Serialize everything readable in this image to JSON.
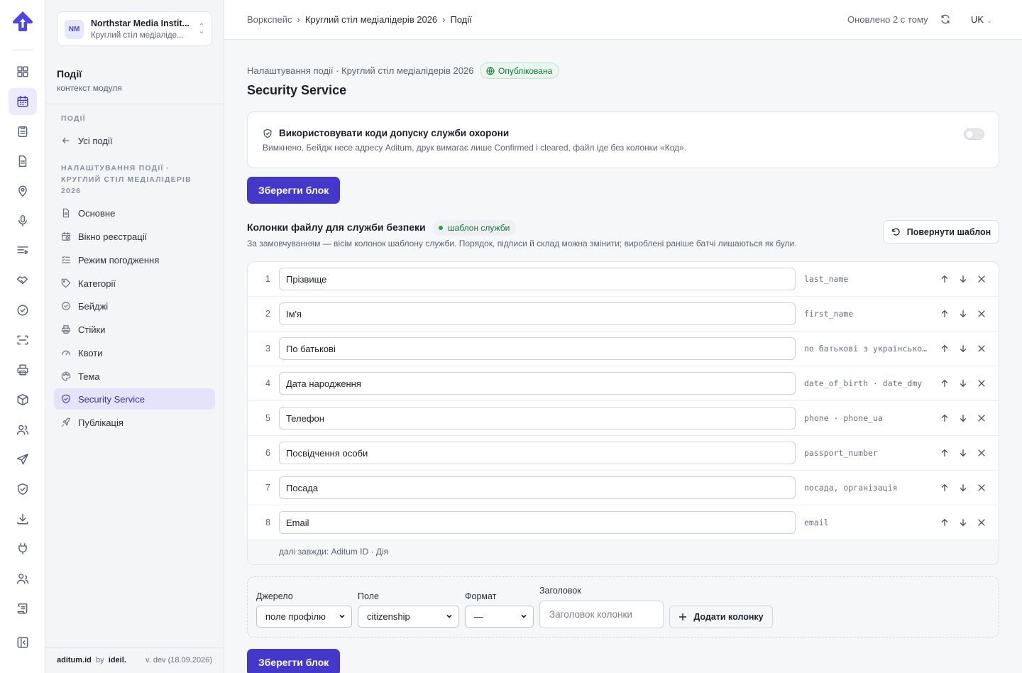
{
  "colors": {
    "accent": "#4338ca",
    "published": "#16733a"
  },
  "rail": {
    "icons": [
      "dashboard-icon",
      "calendar-icon",
      "clipboard-icon",
      "document-icon",
      "location-icon",
      "microphone-icon",
      "agenda-icon",
      "handshake-icon",
      "check-circle-icon",
      "scan-icon",
      "printer-icon",
      "package-icon",
      "users-icon",
      "send-icon",
      "shield-icon",
      "download-icon",
      "plug-icon",
      "team-icon",
      "scroll-icon",
      "sidebar-toggle-icon"
    ]
  },
  "org": {
    "initials": "NM",
    "name": "Northstar Media Instit...",
    "event": "Круглий стіл медіаліде..."
  },
  "module": {
    "title": "Події",
    "subtitle": "контекст модуля"
  },
  "sidenav": {
    "section1": "ПОДІЇ",
    "back": "Усі події",
    "section2": "НАЛАШТУВАННЯ ПОДІЇ · КРУГЛИЙ СТІЛ МЕДІАЛІДЕРІВ 2026",
    "items": [
      {
        "label": "Основне",
        "icon": "file-icon"
      },
      {
        "label": "Вікно реєстрації",
        "icon": "calendar-clock-icon"
      },
      {
        "label": "Режим погодження",
        "icon": "list-check-icon"
      },
      {
        "label": "Категорії",
        "icon": "tag-icon"
      },
      {
        "label": "Бейджі",
        "icon": "badge-check-icon"
      },
      {
        "label": "Стійки",
        "icon": "printer-icon"
      },
      {
        "label": "Квоти",
        "icon": "gauge-icon"
      },
      {
        "label": "Тема",
        "icon": "palette-icon"
      },
      {
        "label": "Security Service",
        "icon": "shield-check-icon"
      },
      {
        "label": "Публікація",
        "icon": "rocket-icon"
      }
    ],
    "footer_brand": "aditum.id",
    "footer_by": "by",
    "footer_company": "ideil.",
    "footer_version": "v. dev (18.09.2026)"
  },
  "topbar": {
    "crumbs": [
      "Воркспейс",
      "Круглий стіл медіалідерів 2026",
      "Події"
    ],
    "separator": "›",
    "updated": "Оновлено 2 с тому",
    "lang": "UK"
  },
  "page": {
    "subtitle": "Налаштування події · Круглий стіл медіалідерів 2026",
    "status": "Опублікована",
    "title": "Security Service"
  },
  "codes_card": {
    "title": "Використовувати коди допуску служби охорони",
    "description": "Вимкнено. Бейдж несе адресу Aditum, друк вимагає лише Confirmed і cleared, файл іде без колонки «Код».",
    "enabled": false
  },
  "save_label": "Зберегти блок",
  "columns": {
    "title": "Колонки файлу для служби безпеки",
    "badge": "шаблон служби",
    "description": "За замовчуванням — вісім колонок шаблону служби. Порядок, підписи й склад можна змінити; вироблені раніше батчі лишаються як були.",
    "revert_label": "Повернути шаблон",
    "rows": [
      {
        "n": "1",
        "label": "Прізвище",
        "source": "last_name"
      },
      {
        "n": "2",
        "label": "Ім'я",
        "source": "first_name"
      },
      {
        "n": "3",
        "label": "По батькові",
        "source": "по батькові з українсько…"
      },
      {
        "n": "4",
        "label": "Дата народження",
        "source": "date_of_birth · date_dmy"
      },
      {
        "n": "5",
        "label": "Телефон",
        "source": "phone · phone_ua"
      },
      {
        "n": "6",
        "label": "Посвідчення особи",
        "source": "passport_number"
      },
      {
        "n": "7",
        "label": "Посада",
        "source": "посада, організація"
      },
      {
        "n": "8",
        "label": "Email",
        "source": "email"
      }
    ],
    "footer": "далі завжди: Aditum ID · Дія"
  },
  "add_column": {
    "source_label": "Джерело",
    "source_value": "поле профілю",
    "field_label": "Поле",
    "field_value": "citizenship",
    "format_label": "Формат",
    "format_value": "—",
    "header_label": "Заголовок",
    "header_placeholder": "Заголовок колонки",
    "add_label": "Додати колонку"
  }
}
